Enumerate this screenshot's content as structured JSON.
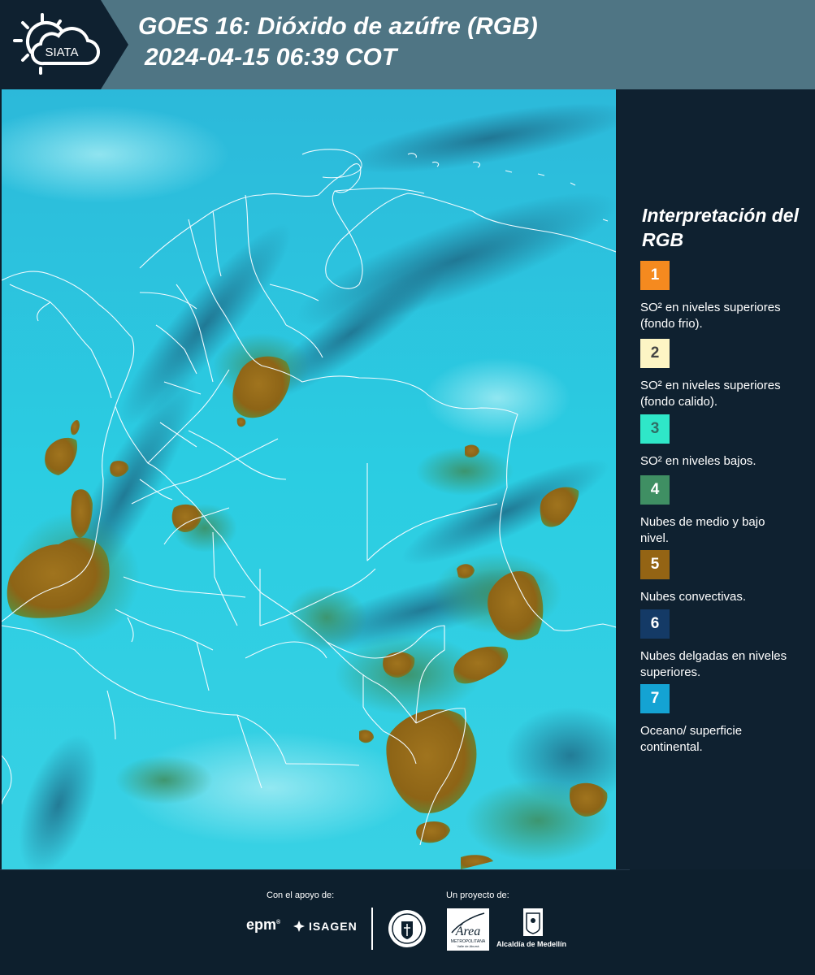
{
  "header": {
    "logo_text": "SIATA",
    "title_line1": "GOES 16: Dióxido de azúfre (RGB)",
    "title_line2": "2024-04-15 06:39 COT"
  },
  "legend": {
    "title": "Interpretación del RGB",
    "items": [
      {
        "number": "1",
        "label": "SO² en niveles superiores (fondo frio).",
        "color": "#f58a1f",
        "text_color": "#ffffff"
      },
      {
        "number": "2",
        "label": "SO² en niveles superiores (fondo calido).",
        "color": "#fdf5c4",
        "text_color": "#444444"
      },
      {
        "number": "3",
        "label": "SO² en niveles bajos.",
        "color": "#2fe7c8",
        "text_color": "#2f6f66"
      },
      {
        "number": "4",
        "label": "Nubes de medio y bajo nivel.",
        "color": "#3f8f63",
        "text_color": "#ffffff"
      },
      {
        "number": "5",
        "label": "Nubes convectivas.",
        "color": "#946414",
        "text_color": "#ffffff"
      },
      {
        "number": "6",
        "label": "Nubes delgadas en niveles superiores.",
        "color": "#143a66",
        "text_color": "#ffffff"
      },
      {
        "number": "7",
        "label": "Oceano/ superficie continental.",
        "color": "#14a3d3",
        "text_color": "#ffffff"
      }
    ]
  },
  "footer": {
    "support_label": "Con el apoyo de:",
    "project_label": "Un proyecto de:",
    "sponsor_epm": "epm",
    "sponsor_isagen": "ISAGEN",
    "area_text": "Área",
    "area_sub1": "METROPOLITANA",
    "area_sub2": "Valle de Aburrá",
    "alcaldia": "Alcaldía de Medellín"
  },
  "colors": {
    "header_bg": "#4f7584",
    "panel_bg": "#0f2130",
    "map_cyan": "#28c6de",
    "cloud_convective": "#946414",
    "cloud_low": "#3f8f63"
  }
}
